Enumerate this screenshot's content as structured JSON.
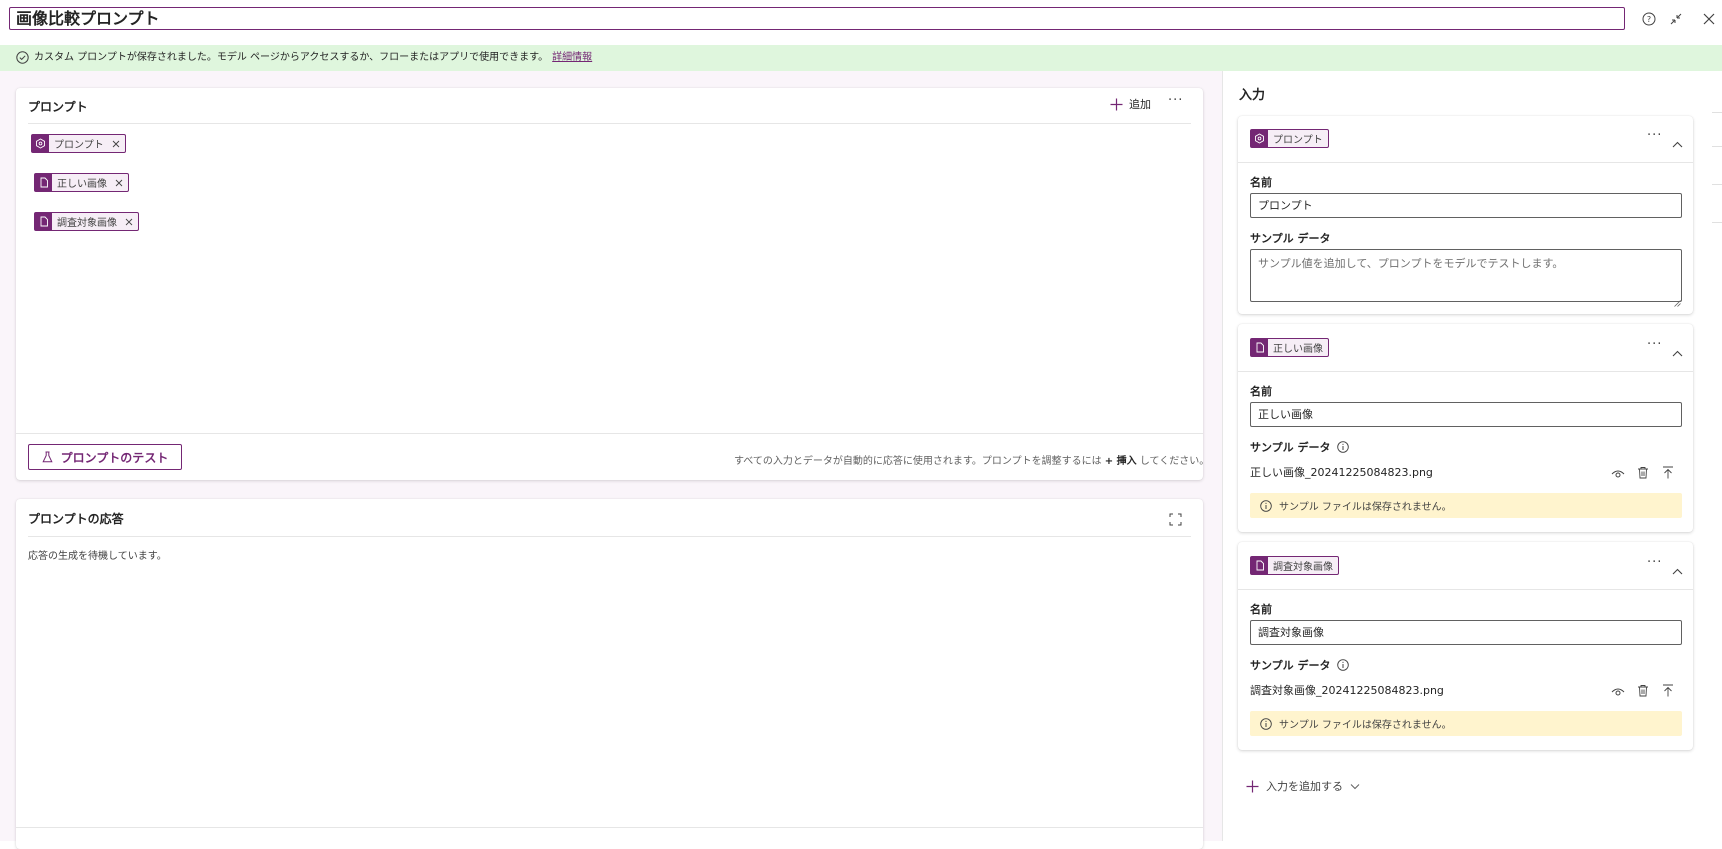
{
  "header": {
    "title": "画像比較プロンプト",
    "help_icon": "help-circle-icon",
    "collapse_icon": "arrows-collapse-icon",
    "close_icon": "close-icon"
  },
  "banner": {
    "message": "カスタム プロンプトが保存されました。モデル ページからアクセスするか、フローまたはアプリで使用できます。",
    "link": "詳細情報",
    "background": "#dff6dd"
  },
  "prompt_editor": {
    "title": "プロンプト",
    "add_label": "追加",
    "chips": [
      {
        "label": "プロンプト",
        "icon": "prompt-icon"
      },
      {
        "label": "正しい画像",
        "icon": "document-icon"
      },
      {
        "label": "調査対象画像",
        "icon": "document-icon"
      }
    ],
    "test_button": "プロンプトのテスト",
    "footer_note_1": "すべての入力とデータが自動的に応答に使用されます。プロンプトを調整するには",
    "footer_note_insert": "+ 挿入",
    "footer_note_2": "してください。"
  },
  "response": {
    "title": "プロンプトの応答",
    "status": "応答の生成を待機しています。"
  },
  "inputs": {
    "title": "入力",
    "cards": [
      {
        "chip": "プロンプト",
        "name_label": "名前",
        "name_value": "プロンプト",
        "sample_label": "サンプル データ",
        "sample_placeholder": "サンプル値を追加して、プロンプトをモデルでテストします。"
      },
      {
        "chip": "正しい画像",
        "name_label": "名前",
        "name_value": "正しい画像",
        "sample_label": "サンプル データ",
        "file_name": "正しい画像_20241225084823.png",
        "warning": "サンプル ファイルは保存されません。"
      },
      {
        "chip": "調査対象画像",
        "name_label": "名前",
        "name_value": "調査対象画像",
        "sample_label": "サンプル データ",
        "file_name": "調査対象画像_20241225084823.png",
        "warning": "サンプル ファイルは保存されません。"
      }
    ],
    "add_input_label": "入力を追加する"
  },
  "colors": {
    "accent": "#742774",
    "warning_bg": "#fff4ce",
    "editor_bg": "#faf5fa"
  }
}
